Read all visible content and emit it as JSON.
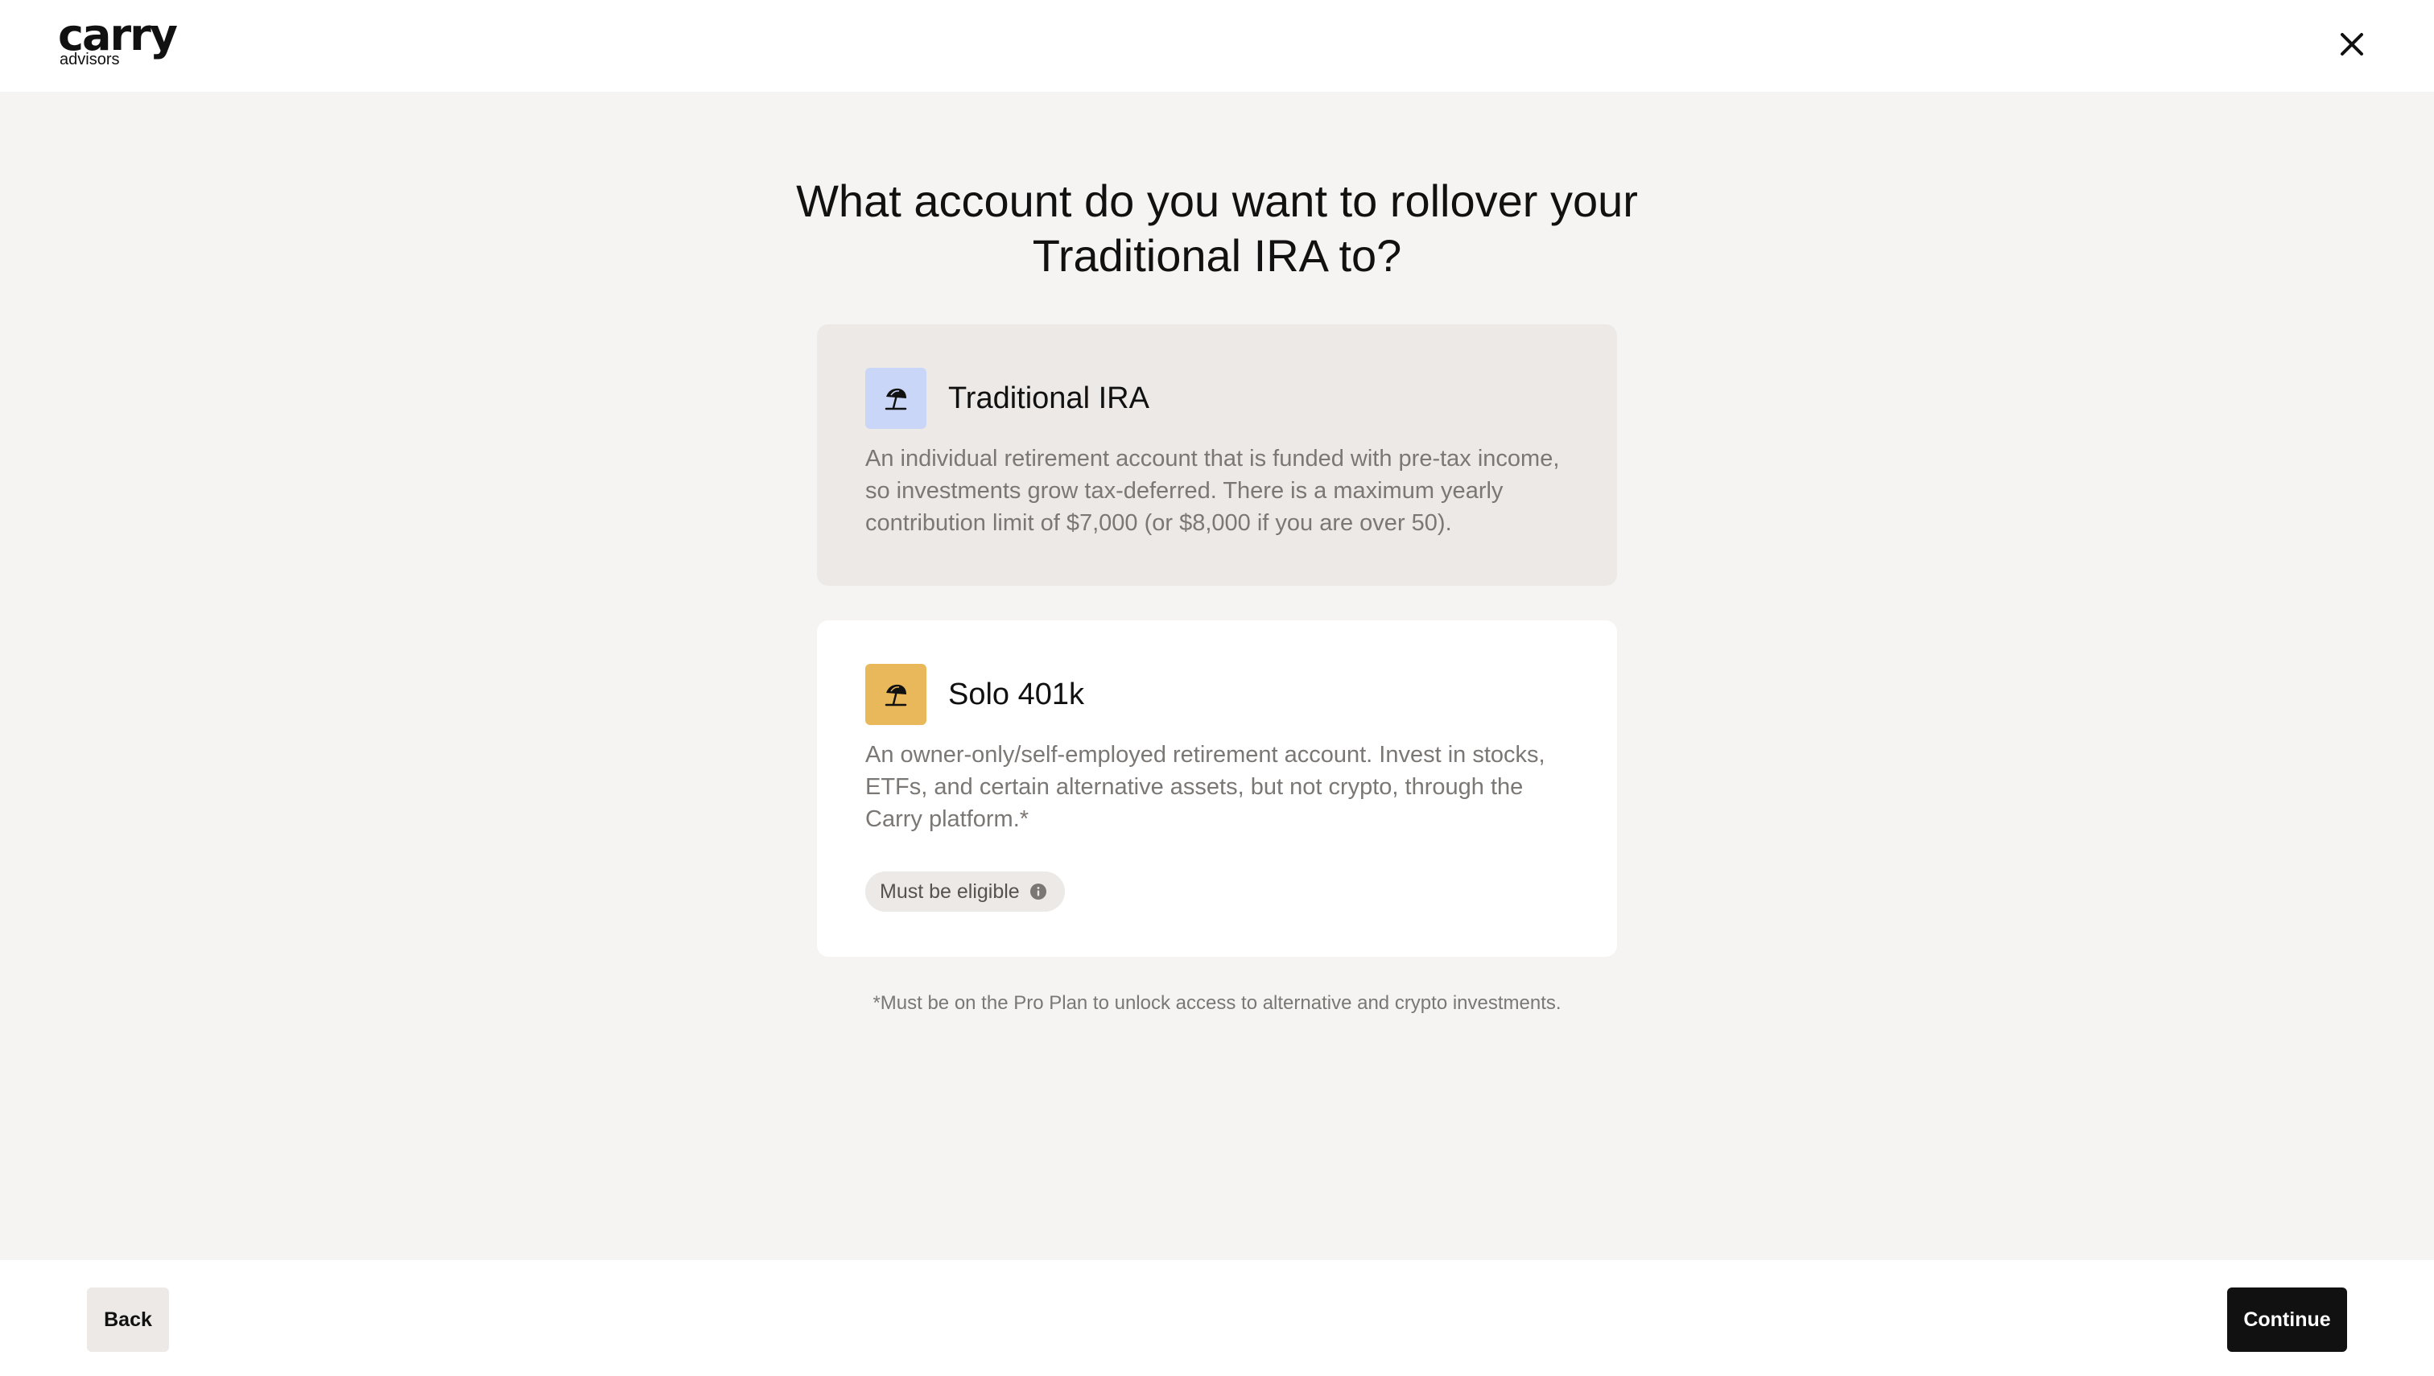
{
  "header": {
    "logo_main": "carry",
    "logo_sub": "advisors",
    "close_icon": "close-icon"
  },
  "main": {
    "title": "What account do you want to rollover your Traditional IRA to?",
    "options": [
      {
        "title": "Traditional IRA",
        "icon": "beach-umbrella-icon",
        "icon_bg": "#c9d6f7",
        "card_bg": "#ece9e6",
        "selected": true,
        "description": "An individual retirement account that is funded with pre-tax income, so investments grow tax-deferred. There is a maximum yearly contribution limit of $7,000 (or $8,000 if you are over 50)."
      },
      {
        "title": "Solo 401k",
        "icon": "beach-umbrella-icon",
        "icon_bg": "#e8b85a",
        "card_bg": "#ffffff",
        "selected": false,
        "description": "An owner-only/self-employed retirement account. Invest in stocks, ETFs, and certain alternative assets, but not crypto, through the Carry platform.*",
        "badge": {
          "label": "Must be eligible",
          "icon": "info-icon"
        }
      }
    ],
    "footnote": "*Must be on the Pro Plan to unlock access to alternative and crypto investments."
  },
  "footer": {
    "back_label": "Back",
    "continue_label": "Continue"
  },
  "colors": {
    "page_bg": "#f5f4f2",
    "primary_button": "#111111",
    "secondary_button": "#ece9e6"
  }
}
